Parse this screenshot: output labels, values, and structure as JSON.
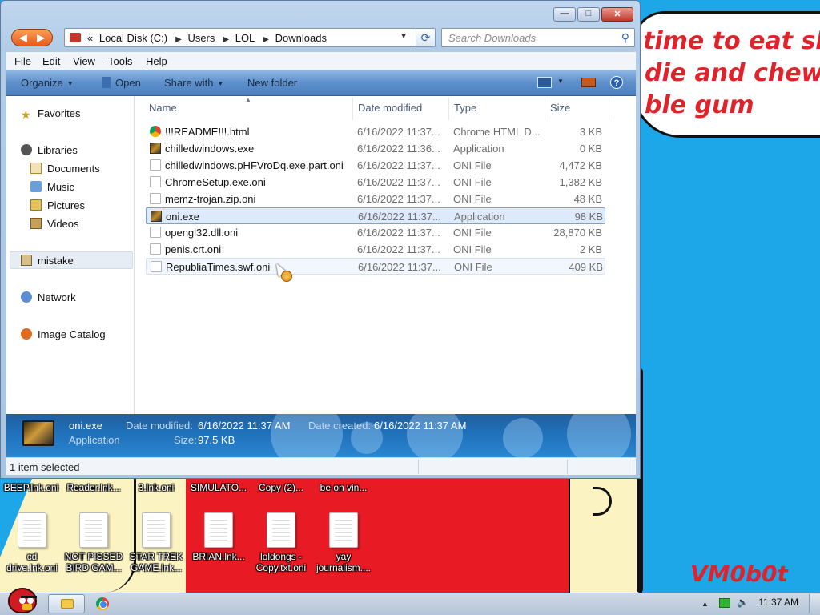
{
  "wallpaper": {
    "speech_lines": [
      "time to eat shit",
      "die and chew",
      "ble gum"
    ],
    "signature": "VM0b0t",
    "colors": {
      "sky": "#1ea7e8",
      "red": "#e81a24",
      "cream": "#fcf3c2",
      "text_red": "#e0222a"
    }
  },
  "window": {
    "controls": {
      "minimize_icon": "minimize-icon",
      "maximize_icon": "maximize-icon",
      "close_icon": "close-icon"
    },
    "address": {
      "chevron": "«",
      "crumbs": [
        "Local Disk (C:)",
        "Users",
        "LOL",
        "Downloads"
      ],
      "search_placeholder": "Search Downloads"
    },
    "menu": [
      "File",
      "Edit",
      "View",
      "Tools",
      "Help"
    ],
    "commands": {
      "organize": "Organize",
      "open": "Open",
      "share": "Share with",
      "new_folder": "New folder"
    },
    "nav": {
      "favorites": "Favorites",
      "libraries": "Libraries",
      "documents": "Documents",
      "music": "Music",
      "pictures": "Pictures",
      "videos": "Videos",
      "user": "mistake",
      "network": "Network",
      "image_catalog": "Image Catalog"
    },
    "columns": {
      "name": "Name",
      "date": "Date modified",
      "type": "Type",
      "size": "Size"
    },
    "files": [
      {
        "name": "!!!README!!!.html",
        "date": "6/16/2022 11:37...",
        "type": "Chrome HTML D...",
        "size": "3 KB",
        "icon": "chrome-icon"
      },
      {
        "name": "chilledwindows.exe",
        "date": "6/16/2022 11:36...",
        "type": "Application",
        "size": "0 KB",
        "icon": "app-icon"
      },
      {
        "name": "chilledwindows.pHFVroDq.exe.part.oni",
        "date": "6/16/2022 11:37...",
        "type": "ONI File",
        "size": "4,472 KB",
        "icon": "file-icon"
      },
      {
        "name": "ChromeSetup.exe.oni",
        "date": "6/16/2022 11:37...",
        "type": "ONI File",
        "size": "1,382 KB",
        "icon": "file-icon"
      },
      {
        "name": "memz-trojan.zip.oni",
        "date": "6/16/2022 11:37...",
        "type": "ONI File",
        "size": "48 KB",
        "icon": "file-icon"
      },
      {
        "name": "oni.exe",
        "date": "6/16/2022 11:37...",
        "type": "Application",
        "size": "98 KB",
        "icon": "app-icon"
      },
      {
        "name": "opengl32.dll.oni",
        "date": "6/16/2022 11:37...",
        "type": "ONI File",
        "size": "28,870 KB",
        "icon": "file-icon"
      },
      {
        "name": "penis.crt.oni",
        "date": "6/16/2022 11:37...",
        "type": "ONI File",
        "size": "2 KB",
        "icon": "file-icon"
      },
      {
        "name": "RepubliaTimes.swf.oni",
        "date": "6/16/2022 11:37...",
        "type": "ONI File",
        "size": "409 KB",
        "icon": "file-icon"
      }
    ],
    "details": {
      "name": "oni.exe",
      "kind": "Application",
      "modified_label": "Date modified:",
      "modified_value": "6/16/2022 11:37 AM",
      "created_label": "Date created:",
      "created_value": "6/16/2022 11:37 AM",
      "size_label": "Size:",
      "size_value": "97.5 KB"
    },
    "status": "1 item selected"
  },
  "desktop_icons": {
    "top_labels": [
      "BEEP.lnk.oni",
      "Reader.lnk...",
      "3.lnk.oni",
      "SIMULATO...",
      "Copy (2)...",
      "be on vin..."
    ],
    "icons": [
      {
        "line1": "cd",
        "line2": "drive.lnk.oni"
      },
      {
        "line1": "NOT PISSED",
        "line2": "BIRD GAM..."
      },
      {
        "line1": "STAR TREK",
        "line2": "GAME.lnk..."
      },
      {
        "line1": "BRIAN.lnk...",
        "line2": ""
      },
      {
        "line1": "loldongs -",
        "line2": "Copy.txt.oni"
      },
      {
        "line1": "yay",
        "line2": "journalism...."
      }
    ]
  },
  "taskbar": {
    "clock": "11:37 AM",
    "tray": {
      "arrow": "▲"
    }
  }
}
